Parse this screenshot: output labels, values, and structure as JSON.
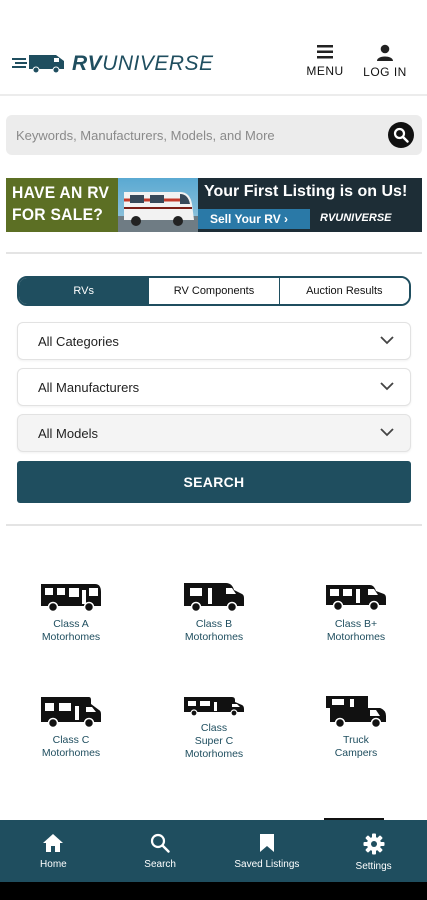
{
  "header": {
    "logo": {
      "brand_bold": "RV",
      "brand_light": "UNIVERSE",
      "mark": "truck-logo-icon"
    },
    "menu_label": "MENU",
    "login_label": "LOG IN"
  },
  "search": {
    "placeholder": "Keywords, Manufacturers, Models, and More"
  },
  "banner": {
    "left_line1": "HAVE AN RV",
    "left_line2": "FOR SALE?",
    "headline": "Your First Listing is on Us!",
    "cta": "Sell Your RV  ›",
    "brand": "RVUNIVERSE"
  },
  "tabs": [
    {
      "label": "RVs",
      "active": true
    },
    {
      "label": "RV Components",
      "active": false
    },
    {
      "label": "Auction Results",
      "active": false
    }
  ],
  "filters": {
    "category": "All Categories",
    "manufacturer": "All Manufacturers",
    "model": "All Models"
  },
  "search_button": "SEARCH",
  "categories": [
    {
      "label": "Class A\nMotorhomes",
      "icon": "class-a-motorhome-icon"
    },
    {
      "label": "Class B\nMotorhomes",
      "icon": "class-b-motorhome-icon"
    },
    {
      "label": "Class B+\nMotorhomes",
      "icon": "class-b-plus-motorhome-icon"
    },
    {
      "label": "Class C\nMotorhomes",
      "icon": "class-c-motorhome-icon"
    },
    {
      "label": "Class\nSuper C\nMotorhomes",
      "icon": "super-c-motorhome-icon"
    },
    {
      "label": "Truck\nCampers",
      "icon": "truck-camper-icon"
    }
  ],
  "bottom_nav": [
    {
      "label": "Home",
      "icon": "home-icon"
    },
    {
      "label": "Search",
      "icon": "search-icon"
    },
    {
      "label": "Saved Listings",
      "icon": "bookmark-icon"
    },
    {
      "label": "Settings",
      "icon": "gear-icon"
    }
  ],
  "colors": {
    "primary": "#1f4e5f",
    "banner_green": "#5c6f24",
    "banner_blue": "#2a79a7"
  }
}
